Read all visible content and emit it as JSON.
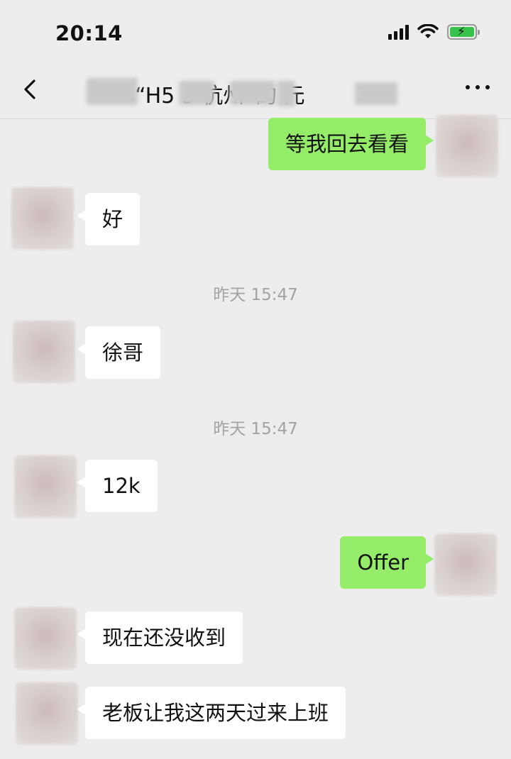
{
  "status_bar": {
    "time": "20:14",
    "icons": [
      "signal-icon",
      "wifi-icon",
      "battery-charging-icon"
    ]
  },
  "nav": {
    "back_icon": "chevron-left-icon",
    "title": "“H5 5 杭州”的 元",
    "more_icon": "more-icon"
  },
  "colors": {
    "background": "#ededed",
    "incoming_bubble": "#ffffff",
    "outgoing_bubble": "#95ec69",
    "timestamp": "#a3a3a3"
  },
  "messages": [
    {
      "type": "text",
      "direction": "out",
      "text": "等我回去看看"
    },
    {
      "type": "text",
      "direction": "in",
      "text": "好"
    },
    {
      "type": "time",
      "text": "昨天 15:47"
    },
    {
      "type": "text",
      "direction": "in",
      "text": "徐哥"
    },
    {
      "type": "time",
      "text": "昨天 15:47"
    },
    {
      "type": "text",
      "direction": "in",
      "text": "12k"
    },
    {
      "type": "text",
      "direction": "out",
      "text": "Offer"
    },
    {
      "type": "text",
      "direction": "in",
      "text": "现在还没收到"
    },
    {
      "type": "text",
      "direction": "in",
      "text": "老板让我这两天过来上班"
    }
  ]
}
